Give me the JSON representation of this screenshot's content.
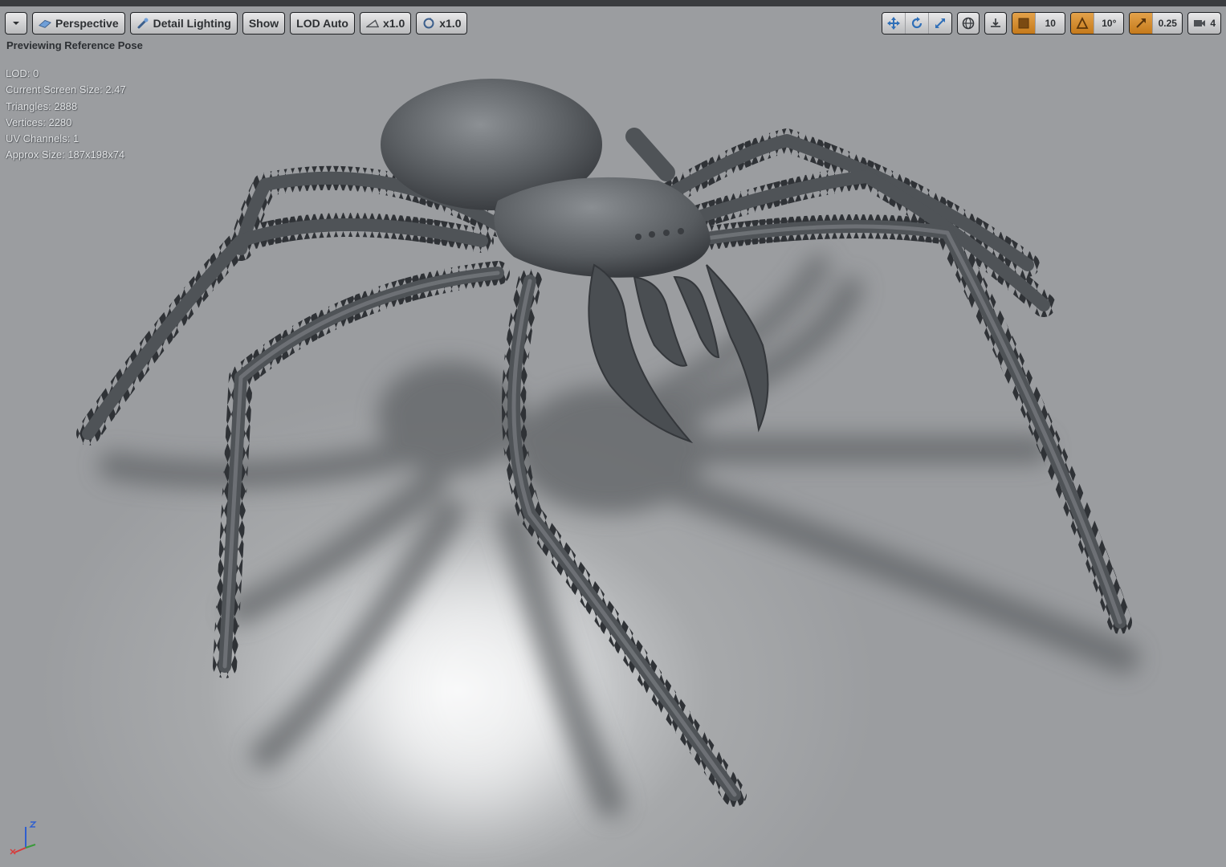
{
  "toolbar": {
    "perspective_label": "Perspective",
    "lighting_label": "Detail Lighting",
    "show_label": "Show",
    "lod_label": "LOD Auto",
    "play_speed_label": "x1.0",
    "turntable_label": "x1.0"
  },
  "snap": {
    "grid_value": "10",
    "rotation_value": "10°",
    "scale_value": "0.25",
    "camera_speed_value": "4"
  },
  "viewport": {
    "preview_title": "Previewing Reference Pose"
  },
  "stats": {
    "lod": "LOD: 0",
    "screen_size": "Current Screen Size: 2.47",
    "triangles": "Triangles: 2888",
    "vertices": "Vertices: 2280",
    "uv_channels": "UV Channels: 1",
    "approx_size": "Approx Size: 187x198x74"
  },
  "colors": {
    "accent": "#d08a2b",
    "floor": "#a3a5a8",
    "mesh": "#4f5357"
  },
  "icons": [
    "dropdown-icon",
    "camera-icon",
    "lighting-icon",
    "speed-icon",
    "turntable-icon",
    "translate-icon",
    "rotate-icon",
    "scale-icon",
    "world-icon",
    "surface-snap-icon",
    "grid-snap-icon",
    "rotation-snap-icon",
    "scale-snap-icon",
    "camera-speed-icon",
    "axis-gizmo-icon"
  ]
}
